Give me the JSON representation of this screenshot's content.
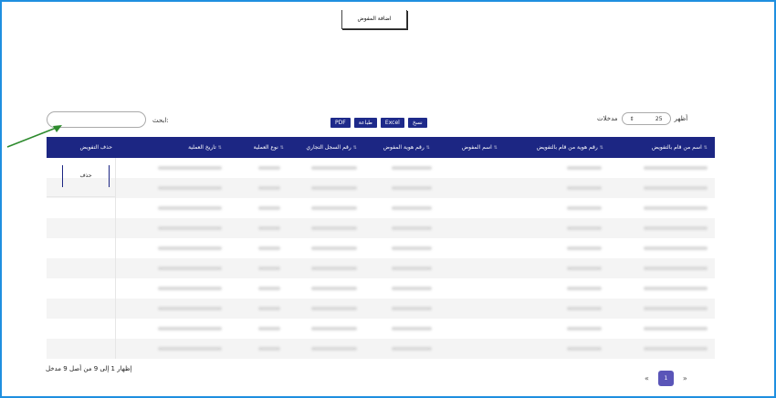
{
  "toolbar": {
    "add_label": "اضافة المفوض"
  },
  "search": {
    "label": "ابحث:",
    "value": ""
  },
  "export": {
    "buttons": [
      "PDF",
      "طباعة",
      "Excel",
      "نسخ"
    ]
  },
  "length": {
    "show_label": "أظهر",
    "value": "25",
    "caret": "⇕",
    "entries_label": "مدخلات"
  },
  "table": {
    "headers": [
      "اسم من قام بالتفويض",
      "رقم هوية من قام بالتفويض",
      "اسم المفوض",
      "رقم هوية المفوض",
      "رقم السجل التجاري",
      "نوع العملية",
      "تاريخ العملية",
      "حذف التفويض"
    ],
    "sort_glyph": "⇅",
    "delete_label": "حذف",
    "row_count": 10
  },
  "footer": {
    "info": "إظهار 1 إلى 9 من أصل 9 مدخل",
    "prev": "«",
    "current_page": "1",
    "next": "»"
  }
}
